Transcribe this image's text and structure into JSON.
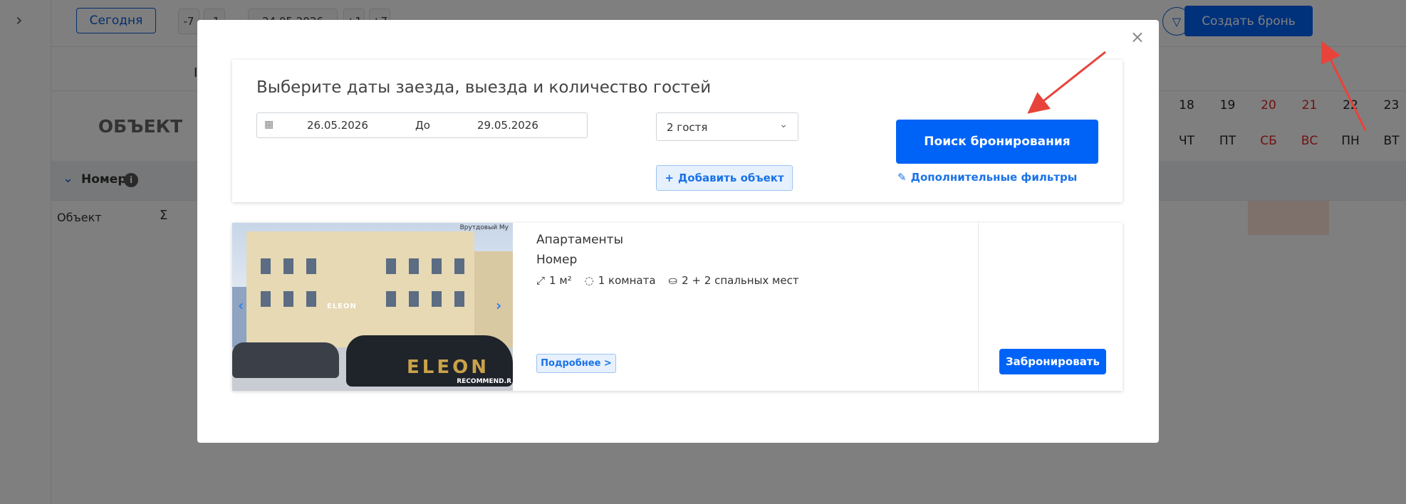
{
  "toolbar": {
    "today_label": "Сегодня",
    "nav_prev7": "-7",
    "nav_prev1": "-1",
    "current_date": "24.05.2026",
    "nav_next1": "+1",
    "nav_next7": "+7",
    "create_booking_label": "Создать бронь"
  },
  "calendar": {
    "subbar_letter": "I",
    "object_header": "ОБЪЕКТ",
    "days": [
      {
        "num": "18",
        "dow": "ЧТ",
        "weekend": false
      },
      {
        "num": "19",
        "dow": "ПТ",
        "weekend": false
      },
      {
        "num": "20",
        "dow": "СБ",
        "weekend": true
      },
      {
        "num": "21",
        "dow": "ВС",
        "weekend": true
      },
      {
        "num": "22",
        "dow": "ПН",
        "weekend": false
      },
      {
        "num": "23",
        "dow": "ВТ",
        "weekend": false
      }
    ],
    "group_label": "Номер",
    "row_label": "Объект"
  },
  "modal": {
    "heading": "Выберите даты заезда, выезда и количество гостей",
    "date_from": "26.05.2026",
    "date_to_label": "До",
    "date_to": "29.05.2026",
    "guests": "2 гостя",
    "add_object": "Добавить объект",
    "search_button": "Поиск бронирования",
    "more_filters": "Дополнительные фильтры"
  },
  "result": {
    "type": "Апартаменты",
    "room": "Номер",
    "area": "1 м²",
    "rooms": "1 комната",
    "beds": "2 + 2 спальных мест",
    "details_button": "Подробнее >",
    "book_button": "Забронировать",
    "photo_sign": "ELEON",
    "photo_car_text": "ELEON",
    "photo_watermark_top": "Врутдовый Му",
    "photo_watermark_bottom": "RECOMMEND.R"
  },
  "colors": {
    "primary": "#0063f7",
    "weekend": "#e02424",
    "annotation_arrow": "#e8433a"
  }
}
